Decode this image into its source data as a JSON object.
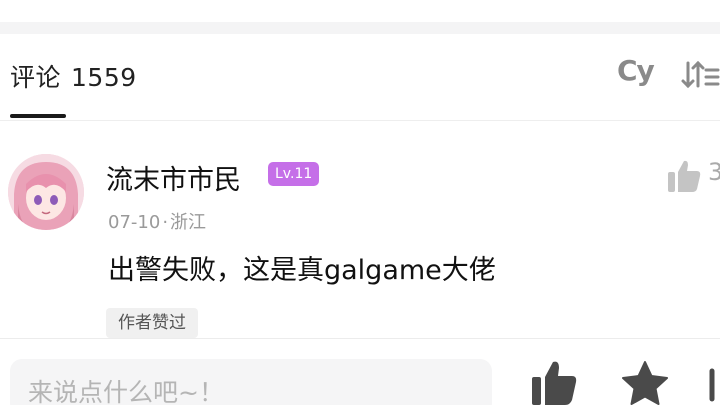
{
  "comments_header": {
    "title": "评论",
    "count": "1559",
    "cy_label": "Cy"
  },
  "comment": {
    "username": "流末市市民",
    "level": "Lv.11",
    "date": "07-10",
    "separator": "·",
    "location": "浙江",
    "text": "出警失败，这是真galgame大佬",
    "author_liked_tag": "作者赞过",
    "like_count": "3"
  },
  "bottom_bar": {
    "input_placeholder": "来说点什么吧~！"
  },
  "colors": {
    "level_badge": "#c56fe8",
    "icon_gray": "#8a8a8a",
    "bar_icon": "#4a4a4a"
  }
}
